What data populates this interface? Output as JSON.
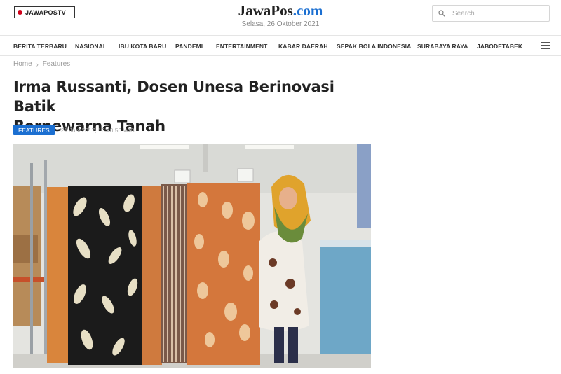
{
  "header": {
    "tv_logo": "JAWAPOSTV",
    "brand_main": "JawaPos",
    "brand_suffix": ".com",
    "date": "Selasa, 26 Oktober 2021",
    "search": {
      "placeholder": "Search",
      "icon": "search-icon"
    }
  },
  "nav": {
    "items": [
      "BERITA TERBARU",
      "NASIONAL",
      "IBU KOTA BARU",
      "PANDEMI",
      "ENTERTAINMENT",
      "KABAR DAERAH",
      "SEPAK BOLA INDONESIA",
      "SURABAYA RAYA",
      "JABODETABEK"
    ],
    "menu_icon": "hamburger-menu-icon"
  },
  "breadcrumb": {
    "home": "Home",
    "separator": "›",
    "section": "Features"
  },
  "article": {
    "title_line1": "Irma Russanti, Dosen Unesa Berinovasi Batik",
    "title_line2": "Berpewarna Tanah",
    "category": "FEATURES",
    "timestamp": "21 Juni 2017, 13:40:56 WIB",
    "image_alt": "Irma Russanti holding earth-toned batik fabrics"
  },
  "colors": {
    "accent": "#1b6fd1",
    "live_dot": "#d0021b",
    "text": "#222222",
    "muted": "#999999"
  }
}
